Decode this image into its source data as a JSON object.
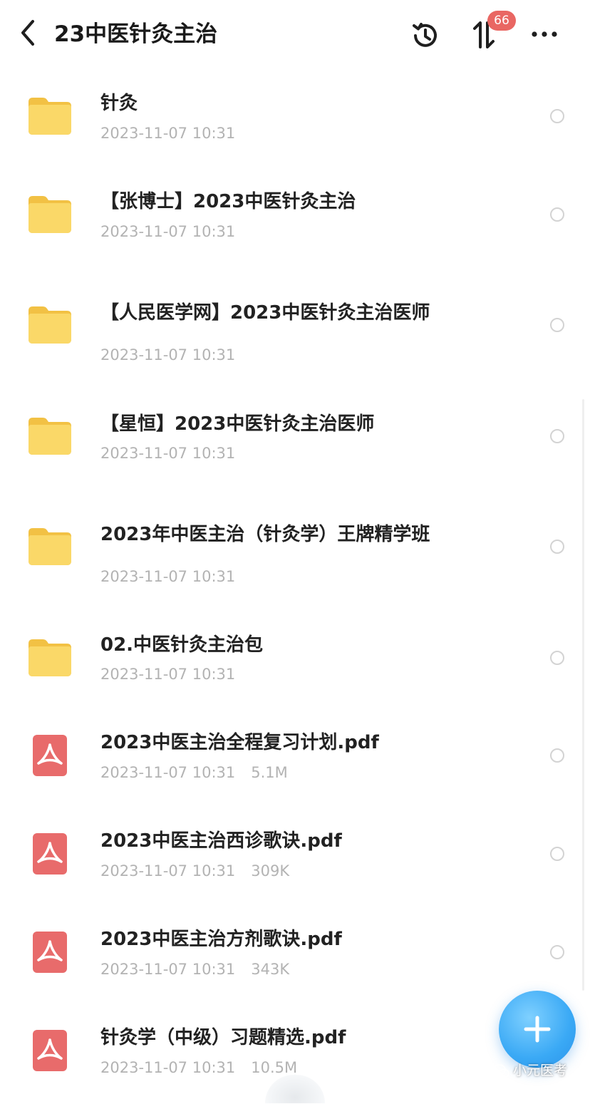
{
  "header": {
    "title": "23中医针灸主治",
    "badge_count": "66",
    "icons": {
      "back": "chevron-left-icon",
      "history": "history-clock-icon",
      "sort": "sort-arrows-icon",
      "more": "more-dots-icon"
    }
  },
  "files": [
    {
      "type": "folder",
      "name": "针灸",
      "date": "2023-11-07 10:31",
      "size": ""
    },
    {
      "type": "folder",
      "name": "【张博士】2023中医针灸主治",
      "date": "2023-11-07 10:31",
      "size": ""
    },
    {
      "type": "folder",
      "name": "【人民医学网】2023中医针灸主治医师",
      "date": "2023-11-07 10:31",
      "size": ""
    },
    {
      "type": "folder",
      "name": "【星恒】2023中医针灸主治医师",
      "date": "2023-11-07 10:31",
      "size": ""
    },
    {
      "type": "folder",
      "name": "2023年中医主治（针灸学）王牌精学班",
      "date": "2023-11-07 10:31",
      "size": ""
    },
    {
      "type": "folder",
      "name": "02.中医针灸主治包",
      "date": "2023-11-07 10:31",
      "size": ""
    },
    {
      "type": "pdf",
      "name": "2023中医主治全程复习计划.pdf",
      "date": "2023-11-07 10:31",
      "size": "5.1M"
    },
    {
      "type": "pdf",
      "name": "2023中医主治西诊歌诀.pdf",
      "date": "2023-11-07 10:31",
      "size": "309K"
    },
    {
      "type": "pdf",
      "name": "2023中医主治方剂歌诀.pdf",
      "date": "2023-11-07 10:31",
      "size": "343K"
    },
    {
      "type": "pdf",
      "name": "针灸学（中级）习题精选.pdf",
      "date": "2023-11-07 10:31",
      "size": "10.5M"
    }
  ],
  "fab": {
    "icon": "plus-icon"
  },
  "watermark": {
    "text": "小元医考"
  },
  "colors": {
    "folder": "#f7cf55",
    "pdf": "#e86b6b",
    "fab": "#3aa9f5",
    "badge": "#e96763"
  }
}
